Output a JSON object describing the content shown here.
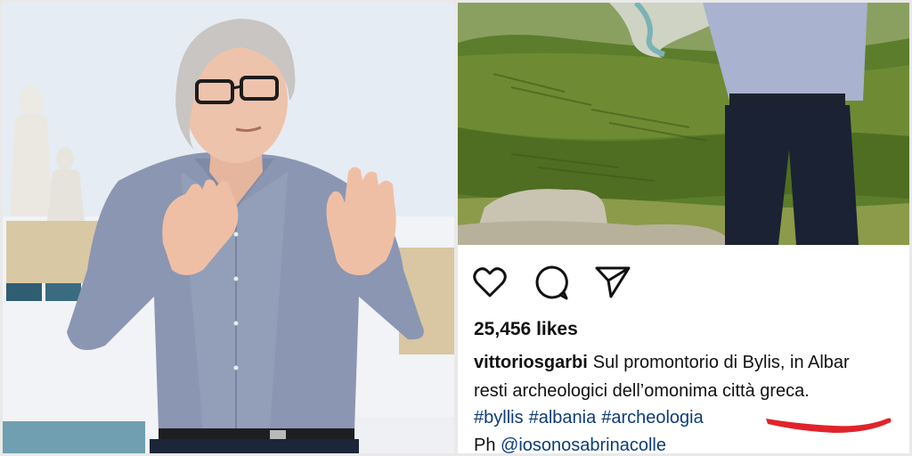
{
  "post": {
    "likes_text": "25,456 likes",
    "username": "vittoriosgarbi",
    "caption_line1": "Sul promontorio di Bylis, in Albar",
    "caption_line2": "resti archeologici dell’omonima città greca.",
    "hashtags": [
      "#byllis",
      "#albania",
      "#archeologia"
    ],
    "credit_prefix": "Ph ",
    "credit_mention": "@iosonosabrinacolle"
  },
  "icons": {
    "like": "heart-icon",
    "comment": "comment-icon",
    "share": "paper-plane-icon"
  },
  "colors": {
    "hashtag": "#0d3c7a",
    "highlight_mark": "#e0242a",
    "shirt": "#8b96b2",
    "landscape_green": "#5c7d2c"
  }
}
